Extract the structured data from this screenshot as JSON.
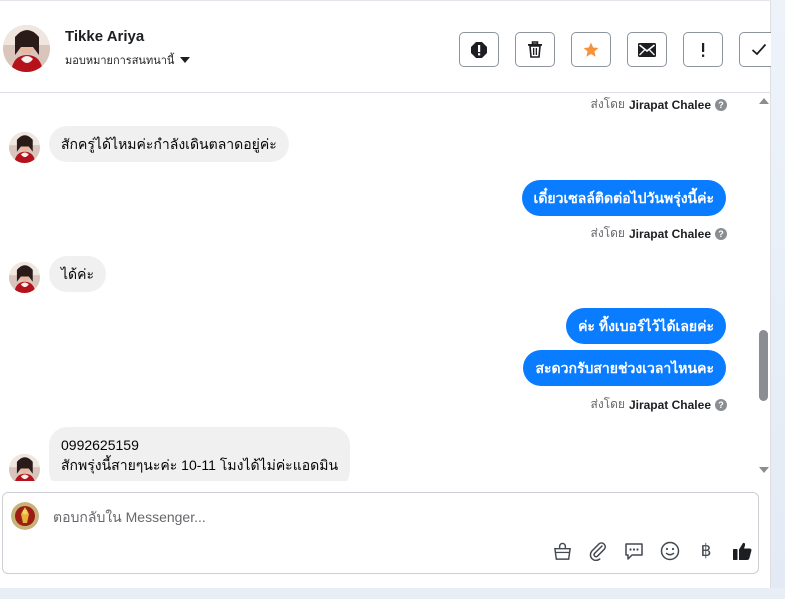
{
  "header": {
    "contact_name": "Tikke Ariya",
    "assign_label": "มอบหมายการสนทนานี้",
    "actions": [
      {
        "name": "mark-spam-button",
        "icon": "alert-octagon-icon"
      },
      {
        "name": "delete-button",
        "icon": "trash-icon"
      },
      {
        "name": "star-button",
        "icon": "star-icon"
      },
      {
        "name": "mark-unread-button",
        "icon": "envelope-icon"
      },
      {
        "name": "follow-up-button",
        "icon": "exclamation-icon"
      },
      {
        "name": "mark-done-button",
        "icon": "checkmark-icon"
      }
    ]
  },
  "colors": {
    "accent_blue": "#0a7cff",
    "incoming_bubble": "#f0f0f0",
    "star_orange": "#f7923b",
    "muted_text": "#65676b"
  },
  "messages": {
    "sent_by_prefix": "ส่งโดย",
    "agent_name": "Jirapat Chalee",
    "help_glyph": "?",
    "items": [
      {
        "text": "สักครู่ได้ไหมค่ะกำลังเดินตลาดอยู่ค่ะ"
      },
      {
        "text": "เดี๋ยวเซลล์ติดต่อไปวันพรุ่งนี้ค่ะ"
      },
      {
        "text": "ได้ค่ะ"
      },
      {
        "text": "ค่ะ ทิ้งเบอร์ไว้ได้เลยค่ะ"
      },
      {
        "text": "สะดวกรับสายช่วงเวลาไหนคะ"
      },
      {
        "line1": "0992625159",
        "line2": "สักพรุ่งนี้สายๆนะค่ะ 10-11 โมงได้ไม่ค่ะแอดมิน"
      }
    ]
  },
  "composer": {
    "placeholder": "ตอบกลับใน Messenger...",
    "tools": [
      "shopping-bag-icon",
      "paperclip-icon",
      "saved-reply-icon",
      "emoji-icon",
      "baht-icon",
      "thumbs-up-icon"
    ],
    "baht_glyph": "฿"
  }
}
